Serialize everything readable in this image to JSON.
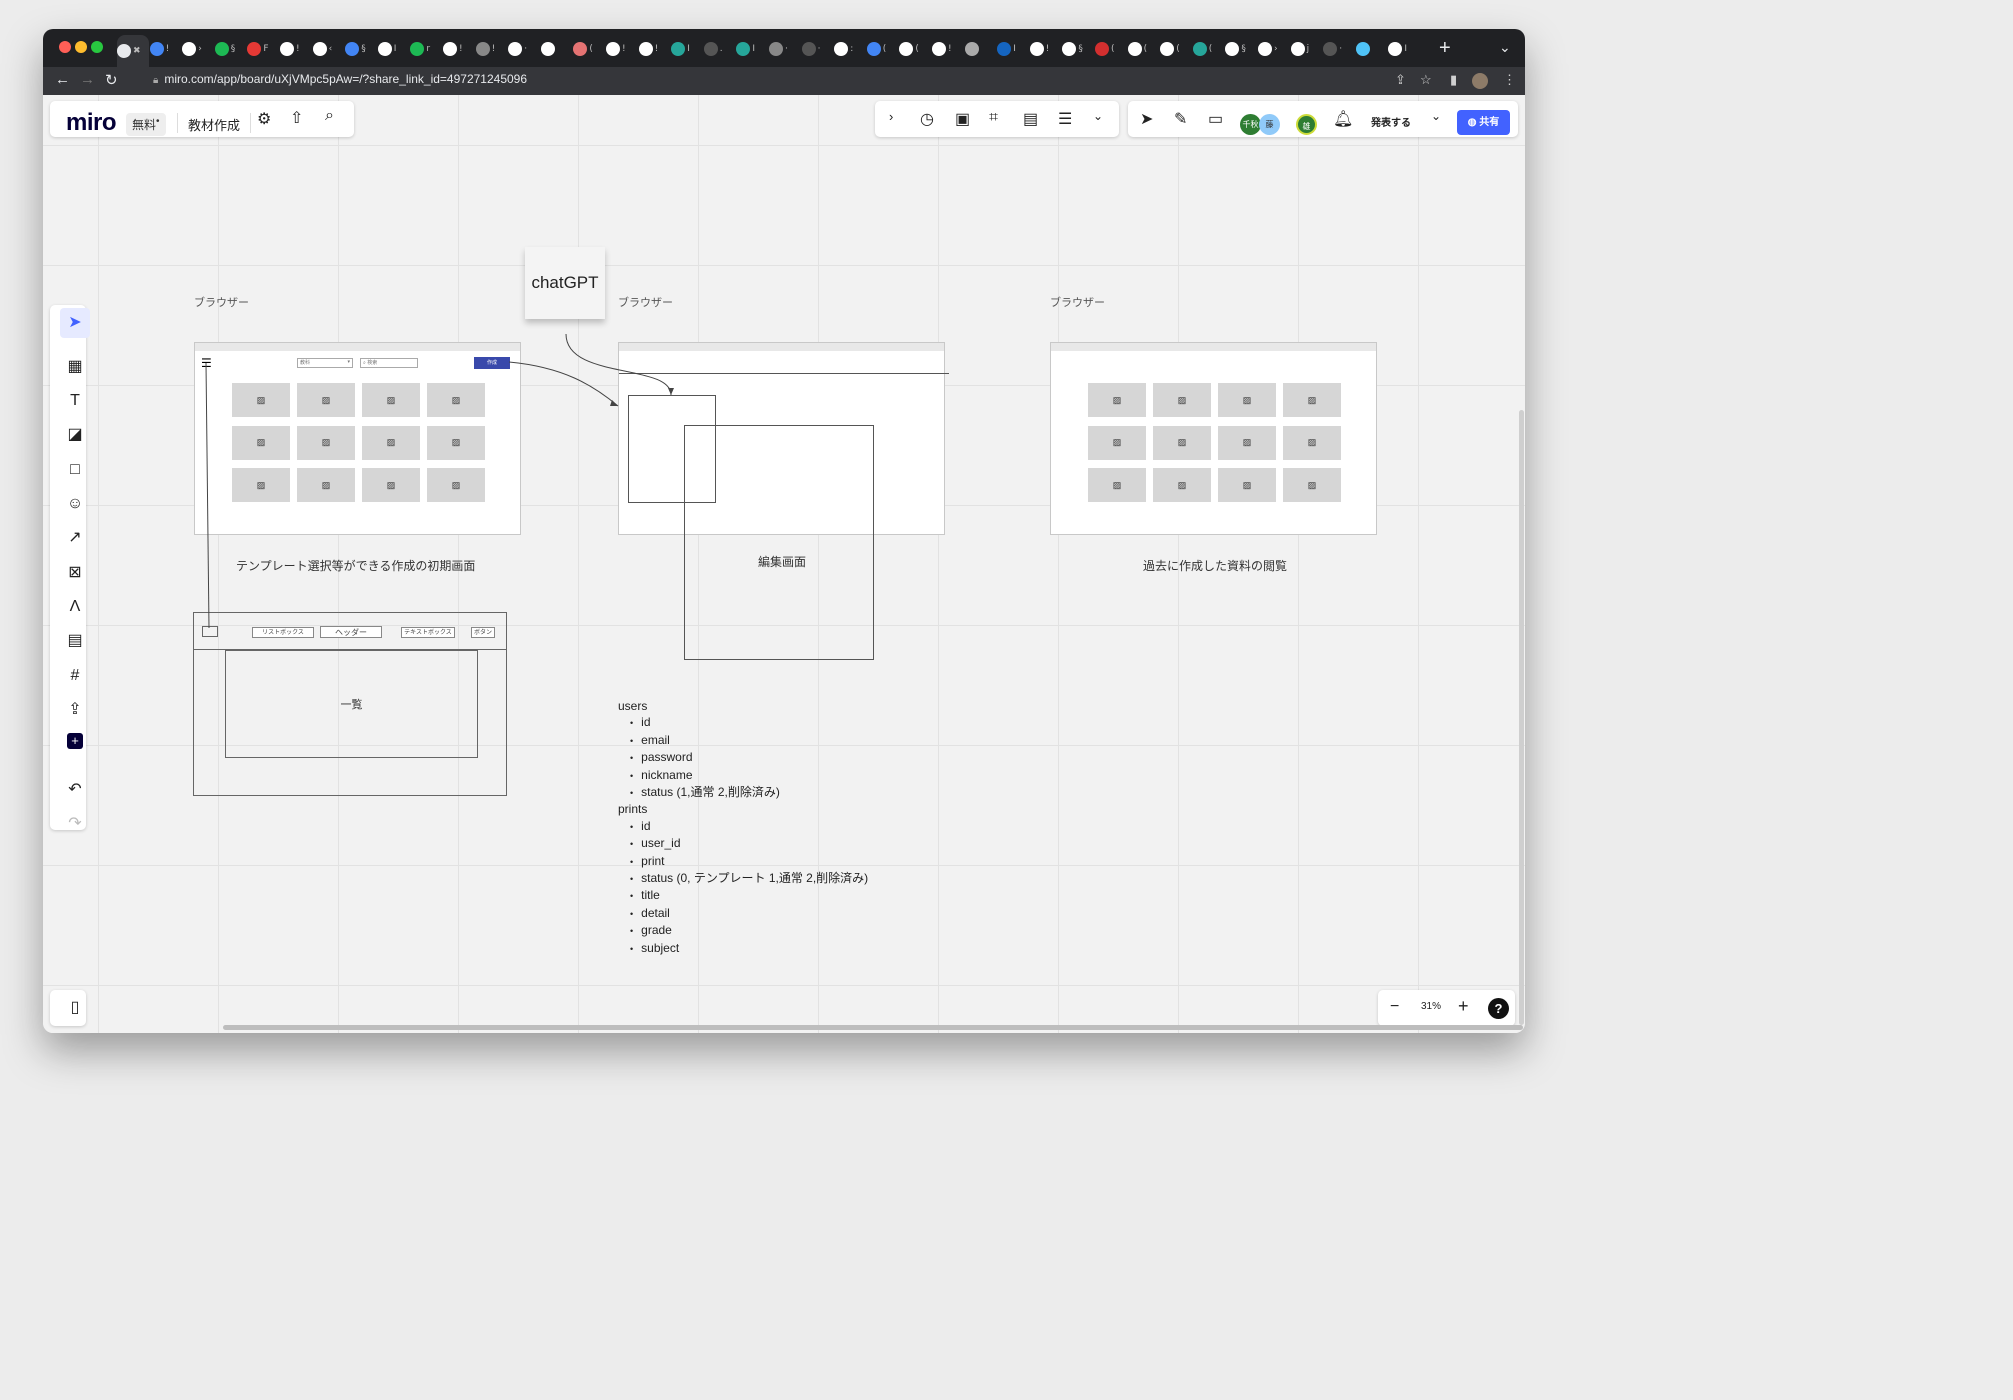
{
  "browser": {
    "url": "miro.com/app/board/uXjVMpc5pAw=/?share_link_id=497271245096",
    "tabs": [
      {
        "color": "#e8eaed",
        "text": "✖"
      },
      {
        "color": "#4285f4",
        "text": "!"
      },
      {
        "color": "#ffffff",
        "text": "›"
      },
      {
        "color": "#1db954",
        "text": "§"
      },
      {
        "color": "#e53935",
        "text": "F"
      },
      {
        "color": "#ffffff",
        "text": "!"
      },
      {
        "color": "#ffffff",
        "text": "‹"
      },
      {
        "color": "#4285f4",
        "text": "§"
      },
      {
        "color": "#ffffff",
        "text": "I"
      },
      {
        "color": "#1db954",
        "text": "r"
      },
      {
        "color": "#ffffff",
        "text": "!"
      },
      {
        "color": "#888888",
        "text": "!"
      },
      {
        "color": "#ffffff",
        "text": "·"
      },
      {
        "color": "#ffffff",
        "text": ""
      },
      {
        "color": "#e57373",
        "text": "("
      },
      {
        "color": "#ffffff",
        "text": "!"
      },
      {
        "color": "#ffffff",
        "text": "!"
      },
      {
        "color": "#26a69a",
        "text": "I"
      },
      {
        "color": "#555555",
        "text": "."
      },
      {
        "color": "#26a69a",
        "text": "I"
      },
      {
        "color": "#888888",
        "text": "·"
      },
      {
        "color": "#555555",
        "text": "·"
      },
      {
        "color": "#ffffff",
        "text": ":"
      },
      {
        "color": "#4285f4",
        "text": "("
      },
      {
        "color": "#ffffff",
        "text": "("
      },
      {
        "color": "#ffffff",
        "text": "!"
      },
      {
        "color": "#aaaaaa",
        "text": ""
      },
      {
        "color": "#1565c0",
        "text": "I"
      },
      {
        "color": "#ffffff",
        "text": "!"
      },
      {
        "color": "#ffffff",
        "text": "§"
      },
      {
        "color": "#d32f2f",
        "text": "("
      },
      {
        "color": "#ffffff",
        "text": "("
      },
      {
        "color": "#ffffff",
        "text": "("
      },
      {
        "color": "#26a69a",
        "text": "("
      },
      {
        "color": "#ffffff",
        "text": "§"
      },
      {
        "color": "#ffffff",
        "text": "›"
      },
      {
        "color": "#ffffff",
        "text": "j"
      },
      {
        "color": "#555555",
        "text": "·"
      },
      {
        "color": "#4fc3f7",
        "text": ""
      },
      {
        "color": "#ffffff",
        "text": "I"
      }
    ]
  },
  "header": {
    "logo": "miro",
    "plan_badge": "無料",
    "board_name": "教材作成",
    "present_label": "発表する",
    "share_label": "共有",
    "avatars": [
      {
        "text": "千秋",
        "color": "#2e7d32"
      },
      {
        "text": "藤",
        "color": "#90caf9"
      },
      {
        "text": "雄",
        "color": "#2e7d32"
      }
    ]
  },
  "board": {
    "sticky": "chatGPT",
    "frame_labels": [
      "ブラウザー",
      "ブラウザー",
      "ブラウザー"
    ],
    "captions": [
      "テンプレート選択等ができる作成の初期画面",
      "編集画面",
      "過去に作成した資料の閲覧"
    ],
    "wire_create_btn": "作成",
    "wire_select": "教科",
    "wire_search": "検索",
    "list_box_label": "一覧",
    "header_buttons": [
      "リストボックス",
      "ヘッダー",
      "テキストボックス",
      "ボタン"
    ],
    "image_icon": "▨",
    "schema": {
      "users_title": "users",
      "users_fields": [
        "id",
        "email",
        "password",
        "nickname",
        "status (1,通常 2,削除済み)"
      ],
      "prints_title": "prints",
      "prints_fields": [
        "id",
        "user_id",
        "print",
        "status (0, テンプレート 1,通常 2,削除済み)",
        "title",
        "detail",
        "grade",
        "subject"
      ]
    }
  },
  "zoom": {
    "level": "31%",
    "minus": "−",
    "plus": "+",
    "help": "?"
  }
}
